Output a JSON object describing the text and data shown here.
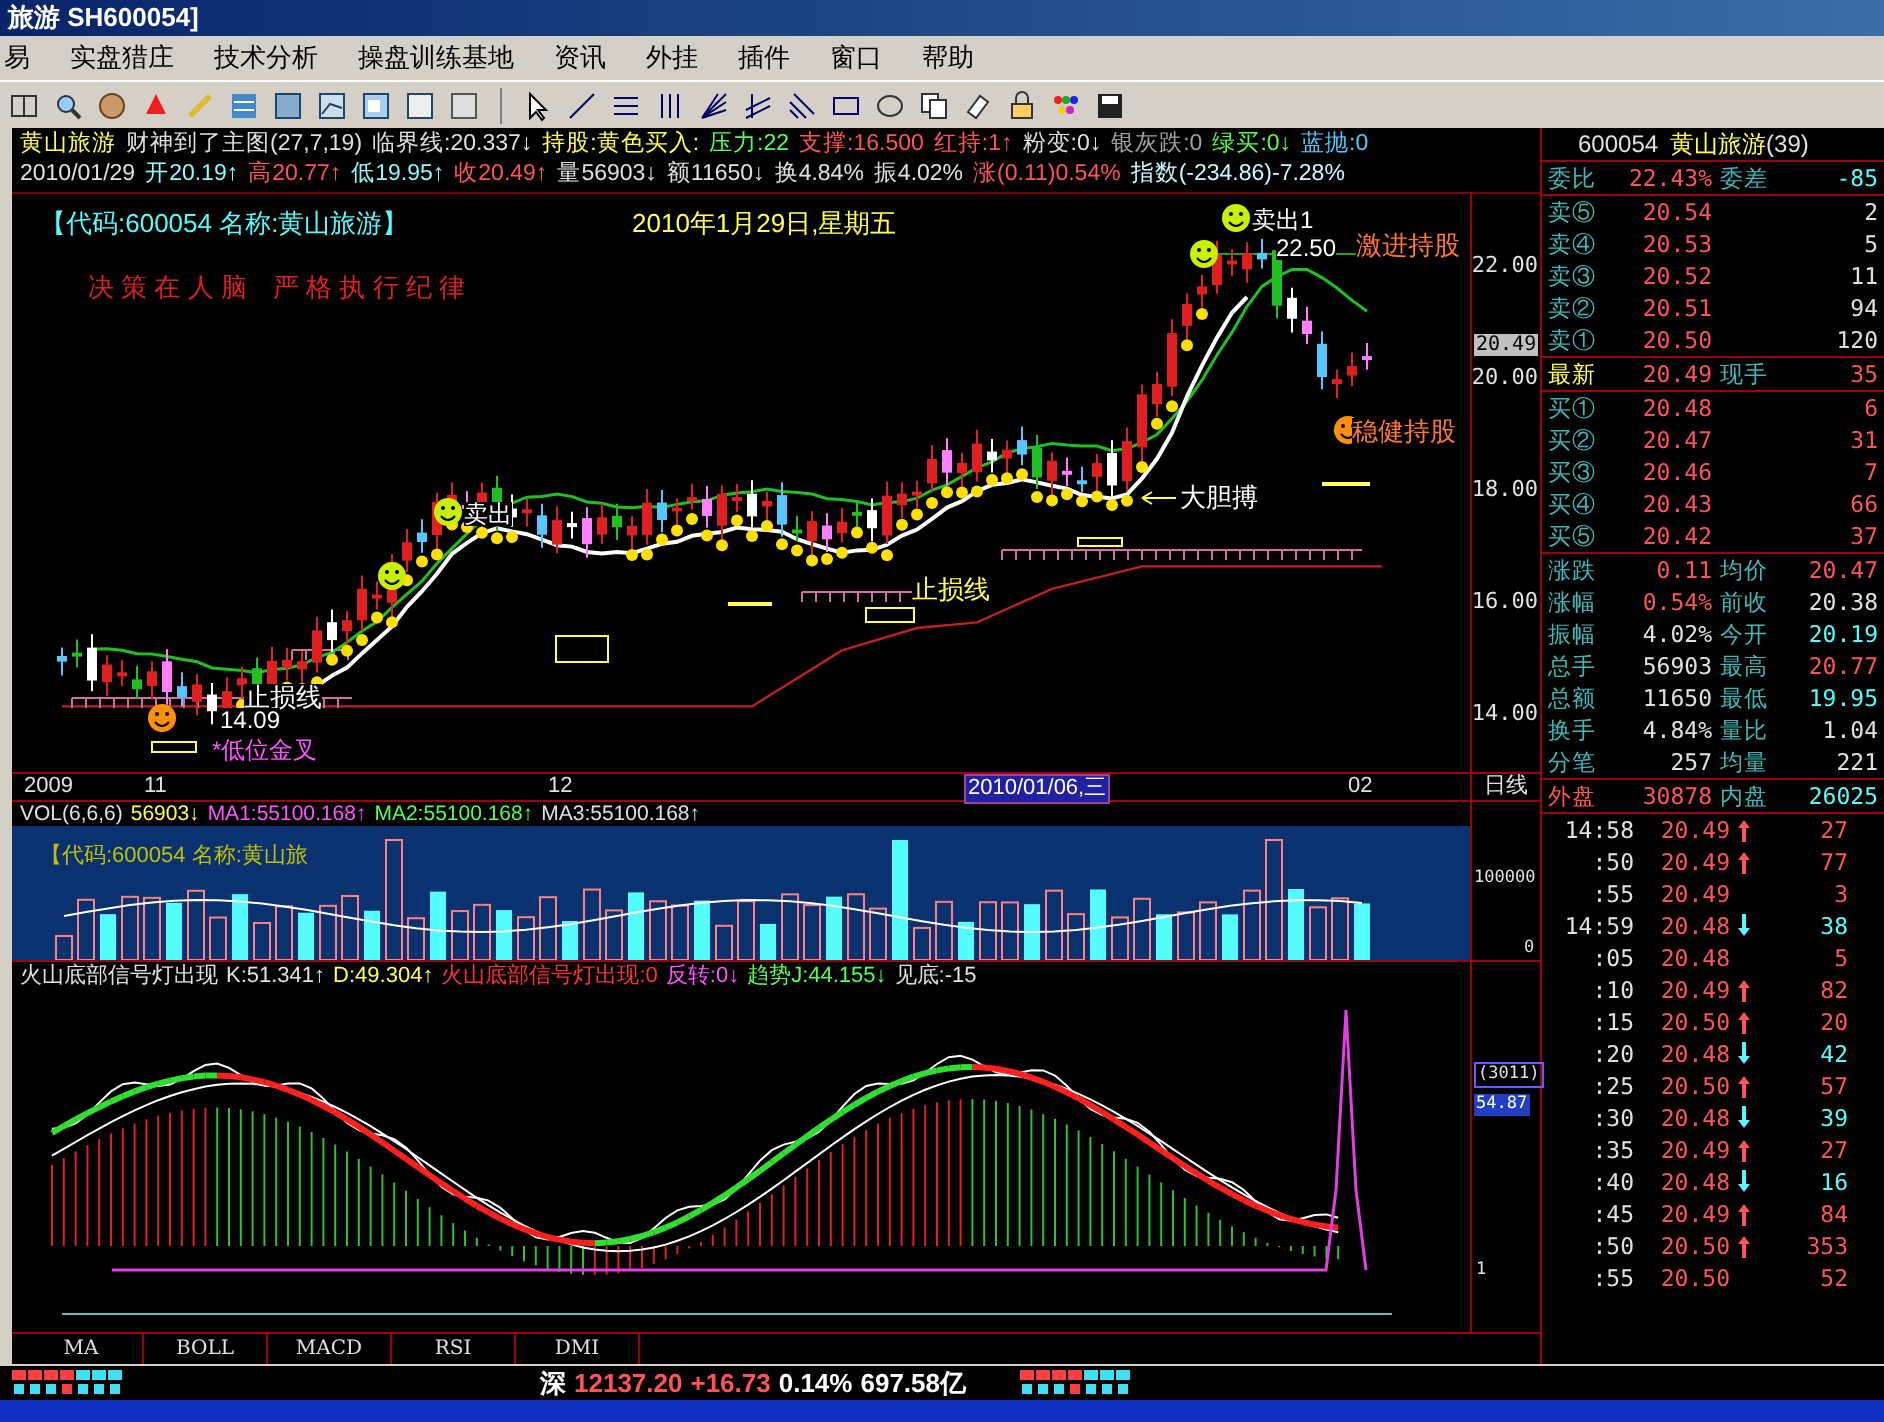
{
  "window": {
    "title": "旅游 SH600054]"
  },
  "menu": [
    "易",
    "实盘猎庄",
    "技术分析",
    "操盘训练基地",
    "资讯",
    "外挂",
    "插件",
    "窗口",
    "帮助"
  ],
  "info_lines": [
    [
      {
        "text": "黄山旅游",
        "color": "#ffff54"
      },
      {
        "text": "财神到了主图(27,7,19)",
        "color": "#e0e0e0"
      },
      {
        "text": "临界线:20.337↓",
        "color": "#e0e0e0"
      },
      {
        "text": "持股:黄色买入:",
        "color": "#ffff54"
      },
      {
        "text": "压力:22",
        "color": "#54ff54"
      },
      {
        "text": "支撑:16.500",
        "color": "#ff5454"
      },
      {
        "text": "红持:1↑",
        "color": "#ff5454"
      },
      {
        "text": "粉变:0↓",
        "color": "#e0e0e0"
      },
      {
        "text": "银灰跌:0",
        "color": "#a0a0a0"
      },
      {
        "text": "绿买:0↓",
        "color": "#54ff54"
      },
      {
        "text": "蓝抛:0",
        "color": "#54c8ff"
      }
    ],
    [
      {
        "text": "2010/01/29",
        "color": "#e0e0e0"
      },
      {
        "text": "开20.19↑",
        "color": "#8cfcfc"
      },
      {
        "text": "高20.77↑",
        "color": "#ff5454"
      },
      {
        "text": "低19.95↑",
        "color": "#8cfcfc"
      },
      {
        "text": "收20.49↑",
        "color": "#ff5454"
      },
      {
        "text": "量56903↓",
        "color": "#e0e0e0"
      },
      {
        "text": "额11650↓",
        "color": "#e0e0e0"
      },
      {
        "text": "换4.84%",
        "color": "#e0e0e0"
      },
      {
        "text": "振4.02%",
        "color": "#e0e0e0"
      },
      {
        "text": "涨(0.11)0.54%",
        "color": "#ff5454"
      },
      {
        "text": "指数(-234.86)-7.28%",
        "color": "#c8fcfc"
      }
    ]
  ],
  "price_chart": {
    "annotations": [
      {
        "text": "【代码:600054 名称:黄山旅游】",
        "color": "#54fcfc"
      },
      {
        "text": "2010年1月29日,星期五",
        "color": "#ffff54"
      },
      {
        "text": "决 策 在 人 脑　严 格 执 行 纪 律",
        "color": "#e02020"
      },
      {
        "text": "卖出1",
        "color": "#ffffff"
      },
      {
        "text": "22.50",
        "color": "#ffffff"
      },
      {
        "text": "激进持股",
        "color": "#ff7830"
      },
      {
        "text": "稳健持股",
        "color": "#ff7830"
      },
      {
        "text": "大胆搏",
        "color": "#ffffff"
      },
      {
        "text": "止损线",
        "color": "#ffff54"
      },
      {
        "text": "止损线",
        "color": "#ffffff"
      },
      {
        "text": "14.09",
        "color": "#ffffff"
      },
      {
        "text": "*低位金叉",
        "color": "#ff54ff"
      },
      {
        "text": "卖出",
        "color": "#ffffff"
      }
    ],
    "axis": [
      "22.00",
      "20.00",
      "18.00",
      "16.00",
      "14.00"
    ],
    "current_price": "20.49"
  },
  "x_axis": {
    "labels": [
      {
        "text": "2009",
        "kind": "date"
      },
      {
        "text": "11",
        "kind": "date"
      },
      {
        "text": "12",
        "kind": "date"
      },
      {
        "text": "2010/01/06,三",
        "kind": "cursor"
      },
      {
        "text": "02",
        "kind": "date"
      }
    ],
    "period": "日线"
  },
  "volume": {
    "header": [
      {
        "text": "VOL(6,6,6)",
        "color": "#e0e0e0"
      },
      {
        "text": "56903↓",
        "color": "#ffff54"
      },
      {
        "text": "MA1:55100.168↑",
        "color": "#ff54ff"
      },
      {
        "text": "MA2:55100.168↑",
        "color": "#54ff54"
      },
      {
        "text": "MA3:55100.168↑",
        "color": "#e0e0e0"
      }
    ],
    "overlay": "【代码:600054 名称:黄山旅",
    "axis": [
      "100000",
      "0"
    ]
  },
  "indicator": {
    "header": [
      {
        "text": "火山底部信号灯出现",
        "color": "#e0e0e0"
      },
      {
        "text": "K:51.341↑",
        "color": "#e0e0e0"
      },
      {
        "text": "D:49.304↑",
        "color": "#ffff54"
      },
      {
        "text": "火山底部信号灯出现:0",
        "color": "#ff3030"
      },
      {
        "text": "反转:0↓",
        "color": "#ff54ff"
      },
      {
        "text": "趋势J:44.155↓",
        "color": "#54ff54"
      },
      {
        "text": "见底:-15",
        "color": "#e0e0e0"
      }
    ],
    "axis": [
      {
        "text": "(3011)",
        "kind": "boxed"
      },
      {
        "text": "54.87",
        "kind": "highlight"
      },
      {
        "text": "1",
        "kind": "plain"
      }
    ]
  },
  "tabs": [
    "MA",
    "BOLL",
    "MACD",
    "RSI",
    "DMI"
  ],
  "status_bar": [
    {
      "text": "深",
      "kind": "plain"
    },
    {
      "text": "12137.20",
      "kind": "rise"
    },
    {
      "text": "+16.73",
      "kind": "rise"
    },
    {
      "text": "0.14%",
      "kind": "plain"
    },
    {
      "text": "697.58亿",
      "kind": "plain"
    }
  ],
  "quote": {
    "code": "600054",
    "name": "黄山旅游",
    "count": "(39)",
    "ratio": {
      "label": "委比",
      "value": "22.43%",
      "label2": "委差",
      "value2": "-85"
    },
    "asks": [
      {
        "label": "卖⑤",
        "price": "20.54",
        "volume": "2"
      },
      {
        "label": "卖④",
        "price": "20.53",
        "volume": "5"
      },
      {
        "label": "卖③",
        "price": "20.52",
        "volume": "11"
      },
      {
        "label": "卖②",
        "price": "20.51",
        "volume": "94"
      },
      {
        "label": "卖①",
        "price": "20.50",
        "volume": "120"
      }
    ],
    "last": {
      "label": "最新",
      "price": "20.49",
      "label2": "现手",
      "volume": "35"
    },
    "bids": [
      {
        "label": "买①",
        "price": "20.48",
        "volume": "6"
      },
      {
        "label": "买②",
        "price": "20.47",
        "volume": "31"
      },
      {
        "label": "买③",
        "price": "20.46",
        "volume": "7"
      },
      {
        "label": "买④",
        "price": "20.43",
        "volume": "66"
      },
      {
        "label": "买⑤",
        "price": "20.42",
        "volume": "37"
      }
    ],
    "stats": [
      {
        "label": "涨跌",
        "value": "0.11",
        "color": "#ff5454"
      },
      {
        "label": "均价",
        "value": "20.47",
        "color": "#ff5454"
      },
      {
        "label": "涨幅",
        "value": "0.54%",
        "color": "#ff5454"
      },
      {
        "label": "前收",
        "value": "20.38",
        "color": "#e0e0e0"
      },
      {
        "label": "振幅",
        "value": "4.02%",
        "color": "#e0e0e0"
      },
      {
        "label": "今开",
        "value": "20.19",
        "color": "#54fcfc"
      },
      {
        "label": "总手",
        "value": "56903",
        "color": "#e0e0e0"
      },
      {
        "label": "最高",
        "value": "20.77",
        "color": "#ff5454"
      },
      {
        "label": "总额",
        "value": "11650",
        "color": "#e0e0e0"
      },
      {
        "label": "最低",
        "value": "19.95",
        "color": "#54fcfc"
      },
      {
        "label": "换手",
        "value": "4.84%",
        "color": "#e0e0e0"
      },
      {
        "label": "量比",
        "value": "1.04",
        "color": "#e0e0e0"
      },
      {
        "label": "分笔",
        "value": "257",
        "color": "#e0e0e0"
      },
      {
        "label": "均量",
        "value": "221",
        "color": "#e0e0e0"
      }
    ],
    "outer_inner": {
      "label": "外盘",
      "value": "30878",
      "label2": "内盘",
      "value2": "26025"
    },
    "ticks": [
      {
        "time": "14:58",
        "price": "20.49",
        "kind": "up",
        "volume": "27"
      },
      {
        "time": ":50",
        "price": "20.49",
        "kind": "up",
        "volume": "77"
      },
      {
        "time": ":55",
        "price": "20.49",
        "kind": "none",
        "volume": "3"
      },
      {
        "time": "14:59",
        "price": "20.48",
        "kind": "down",
        "volume": "38"
      },
      {
        "time": ":05",
        "price": "20.48",
        "kind": "none",
        "volume": "5"
      },
      {
        "time": ":10",
        "price": "20.49",
        "kind": "up",
        "volume": "82"
      },
      {
        "time": ":15",
        "price": "20.50",
        "kind": "up",
        "volume": "20"
      },
      {
        "time": ":20",
        "price": "20.48",
        "kind": "down",
        "volume": "42"
      },
      {
        "time": ":25",
        "price": "20.50",
        "kind": "up",
        "volume": "57"
      },
      {
        "time": ":30",
        "price": "20.48",
        "kind": "down",
        "volume": "39"
      },
      {
        "time": ":35",
        "price": "20.49",
        "kind": "up",
        "volume": "27"
      },
      {
        "time": ":40",
        "price": "20.48",
        "kind": "down",
        "volume": "16"
      },
      {
        "time": ":45",
        "price": "20.49",
        "kind": "up",
        "volume": "84"
      },
      {
        "time": ":50",
        "price": "20.50",
        "kind": "up",
        "volume": "353"
      },
      {
        "time": ":55",
        "price": "20.50",
        "kind": "none",
        "volume": "52"
      }
    ]
  }
}
